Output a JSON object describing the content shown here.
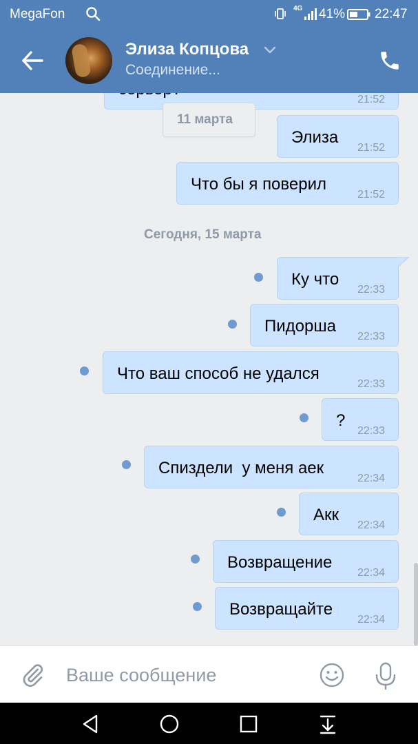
{
  "status_bar": {
    "carrier": "MegaFon",
    "network": "4G",
    "battery_percent": "41%",
    "time": "22:47"
  },
  "header": {
    "contact_name": "Элиза Копцова",
    "contact_status": "Соединение..."
  },
  "partial_message": {
    "text": "сервер?",
    "time": "21:52"
  },
  "date_chip": "11 марта",
  "messages_before": [
    {
      "text": "Элиза",
      "time": "21:52"
    },
    {
      "text": "Что бы я поверил",
      "time": "21:52"
    }
  ],
  "date_separator": "Сегодня, 15 марта",
  "messages_today": [
    {
      "text": "Ку что",
      "time": "22:33",
      "unread": true
    },
    {
      "text": "Пидорша",
      "time": "22:33",
      "unread": true
    },
    {
      "text": "Что ваш способ не удался",
      "time": "22:33",
      "unread": true
    },
    {
      "text": "?",
      "time": "22:33",
      "unread": true
    },
    {
      "text": "Спиздели  у меня аек",
      "time": "22:34",
      "unread": true
    },
    {
      "text": "Акк",
      "time": "22:34",
      "unread": true
    },
    {
      "text": "Возвращение",
      "time": "22:34",
      "unread": true
    },
    {
      "text": "Возвращайте",
      "time": "22:34",
      "unread": true
    }
  ],
  "composer": {
    "placeholder": "Ваше сообщение"
  },
  "icons": {
    "back": "arrow-left-icon",
    "call": "phone-icon",
    "attach": "paperclip-icon",
    "emoji": "smiley-icon",
    "mic": "microphone-icon"
  },
  "colors": {
    "header": "#5181b8",
    "bubble": "#cce4ff",
    "unread_dot": "#6f9bd1",
    "background": "#edeef0"
  }
}
